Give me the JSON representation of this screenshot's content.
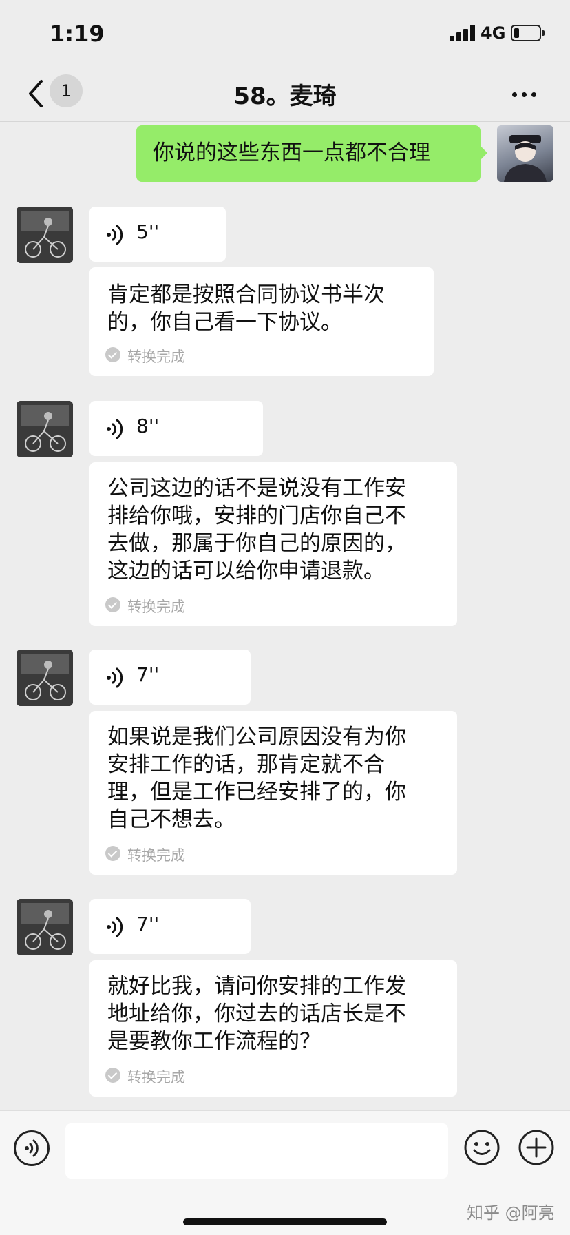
{
  "status_bar": {
    "time": "1:19",
    "network": "4G",
    "battery_level": 0.2
  },
  "nav": {
    "unread_count": "1",
    "title": "58。麦琦"
  },
  "messages": [
    {
      "sender": "me",
      "type": "text",
      "text": "你说的这些东西一点都不合理"
    },
    {
      "sender": "other",
      "type": "voice",
      "duration": "5''",
      "transcript": "肯定都是按照合同协议书半次的，你自己看一下协议。",
      "transcript_lines": [
        "肯定都是按照合同协议书半次",
        "的，你自己看一下协议。"
      ],
      "status": "转换完成"
    },
    {
      "sender": "other",
      "type": "voice",
      "duration": "8''",
      "transcript": "公司这边的话不是说没有工作安排给你哦，安排的门店你自己不去做，那属于你自己的原因的，这边的话可以给你申请退款。",
      "transcript_lines": [
        "公司这边的话不是说没有工作安",
        "排给你哦，安排的门店你自己不",
        "去做，那属于你自己的原因的，",
        "这边的话可以给你申请退款。"
      ],
      "status": "转换完成"
    },
    {
      "sender": "other",
      "type": "voice",
      "duration": "7''",
      "transcript": "如果说是我们公司原因没有为你安排工作的话，那肯定就不合理，但是工作已经安排了的，你自己不想去。",
      "transcript_lines": [
        "如果说是我们公司原因没有为你",
        "安排工作的话，那肯定就不合",
        "理，但是工作已经安排了的，你",
        "自己不想去。"
      ],
      "status": "转换完成"
    },
    {
      "sender": "other",
      "type": "voice",
      "duration": "7''",
      "transcript": "就好比我，请问你安排的工作发地址给你，你过去的话店长是不是要教你工作流程的？",
      "transcript_lines": [
        "就好比我，请问你安排的工作发",
        "地址给你，你过去的话店长是不",
        "是要教你工作流程的？"
      ],
      "status": "转换完成"
    }
  ],
  "input_bar": {
    "message_value": "",
    "watermark": "知乎 @阿亮"
  },
  "icons": {
    "back": "chevron-left-icon",
    "more": "more-dots-icon",
    "voice": "voice-wave-icon",
    "check": "check-circle-icon",
    "voice_toggle": "voice-input-icon",
    "emoji": "emoji-icon",
    "plus": "plus-icon"
  },
  "colors": {
    "background": "#ededed",
    "my_bubble": "#95ec69",
    "other_bubble": "#ffffff",
    "status_text": "#a7a7a7",
    "text": "#111111",
    "badge": "#d6d6d6"
  }
}
